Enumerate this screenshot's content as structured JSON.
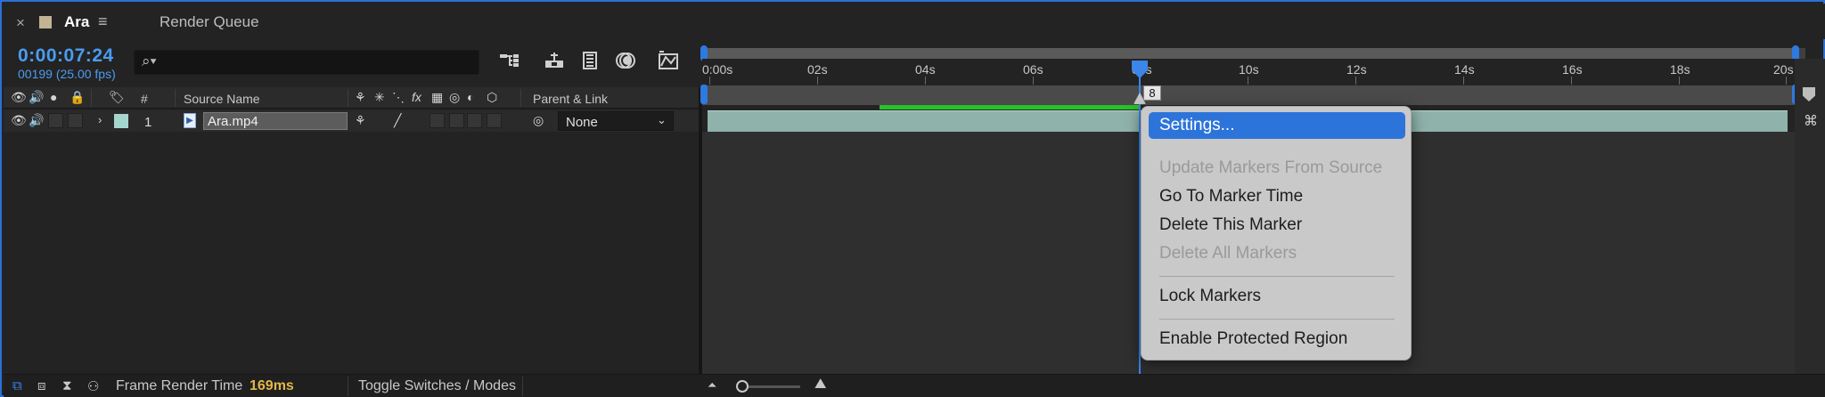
{
  "tabs": [
    {
      "label": "Ara",
      "active": true
    },
    {
      "label": "Render Queue",
      "active": false
    }
  ],
  "tab_close_glyph": "×",
  "tab_menu_glyph": "≡",
  "time": {
    "timecode": "0:00:07:24",
    "frames": "00199 (25.00 fps)"
  },
  "search": {
    "glyph": "⌕▾",
    "value": ""
  },
  "toolbar_icons": [
    "composition-flowchart-icon",
    "draft-3d-icon",
    "frame-blending-icon",
    "motion-blur-icon",
    "graph-editor-icon"
  ],
  "columns": {
    "label_col": "#",
    "source_name": "Source Name",
    "parent_link": "Parent & Link"
  },
  "layer": {
    "number": "1",
    "name": "Ara.mp4",
    "label_color": "#a5d6ce",
    "parent": "None"
  },
  "ruler": {
    "ticks": [
      "0:00s",
      "02s",
      "04s",
      "06s",
      "08s",
      "10s",
      "12s",
      "14s",
      "16s",
      "18s",
      "20s"
    ]
  },
  "playhead": {
    "time": "0:00:07:24",
    "marker_label": "8"
  },
  "context_menu": {
    "items": [
      {
        "label": "Settings...",
        "state": "selected"
      },
      {
        "label": "Update Markers From Source",
        "state": "disabled"
      },
      {
        "label": "Go To Marker Time",
        "state": "enabled"
      },
      {
        "label": "Delete This Marker",
        "state": "enabled"
      },
      {
        "label": "Delete All Markers",
        "state": "disabled"
      },
      {
        "label": "Lock Markers",
        "state": "enabled"
      },
      {
        "label": "Enable Protected Region",
        "state": "enabled"
      }
    ]
  },
  "bottom_bar": {
    "frame_render_label": "Frame Render Time",
    "frame_render_value": "169ms",
    "toggle_label": "Toggle Switches / Modes"
  },
  "colors": {
    "accent": "#2d74da",
    "timecode": "#4a9cf2",
    "render_time": "#e2b64a",
    "cache_bar": "#27c227",
    "layer_bar": "#8fb2ab"
  }
}
